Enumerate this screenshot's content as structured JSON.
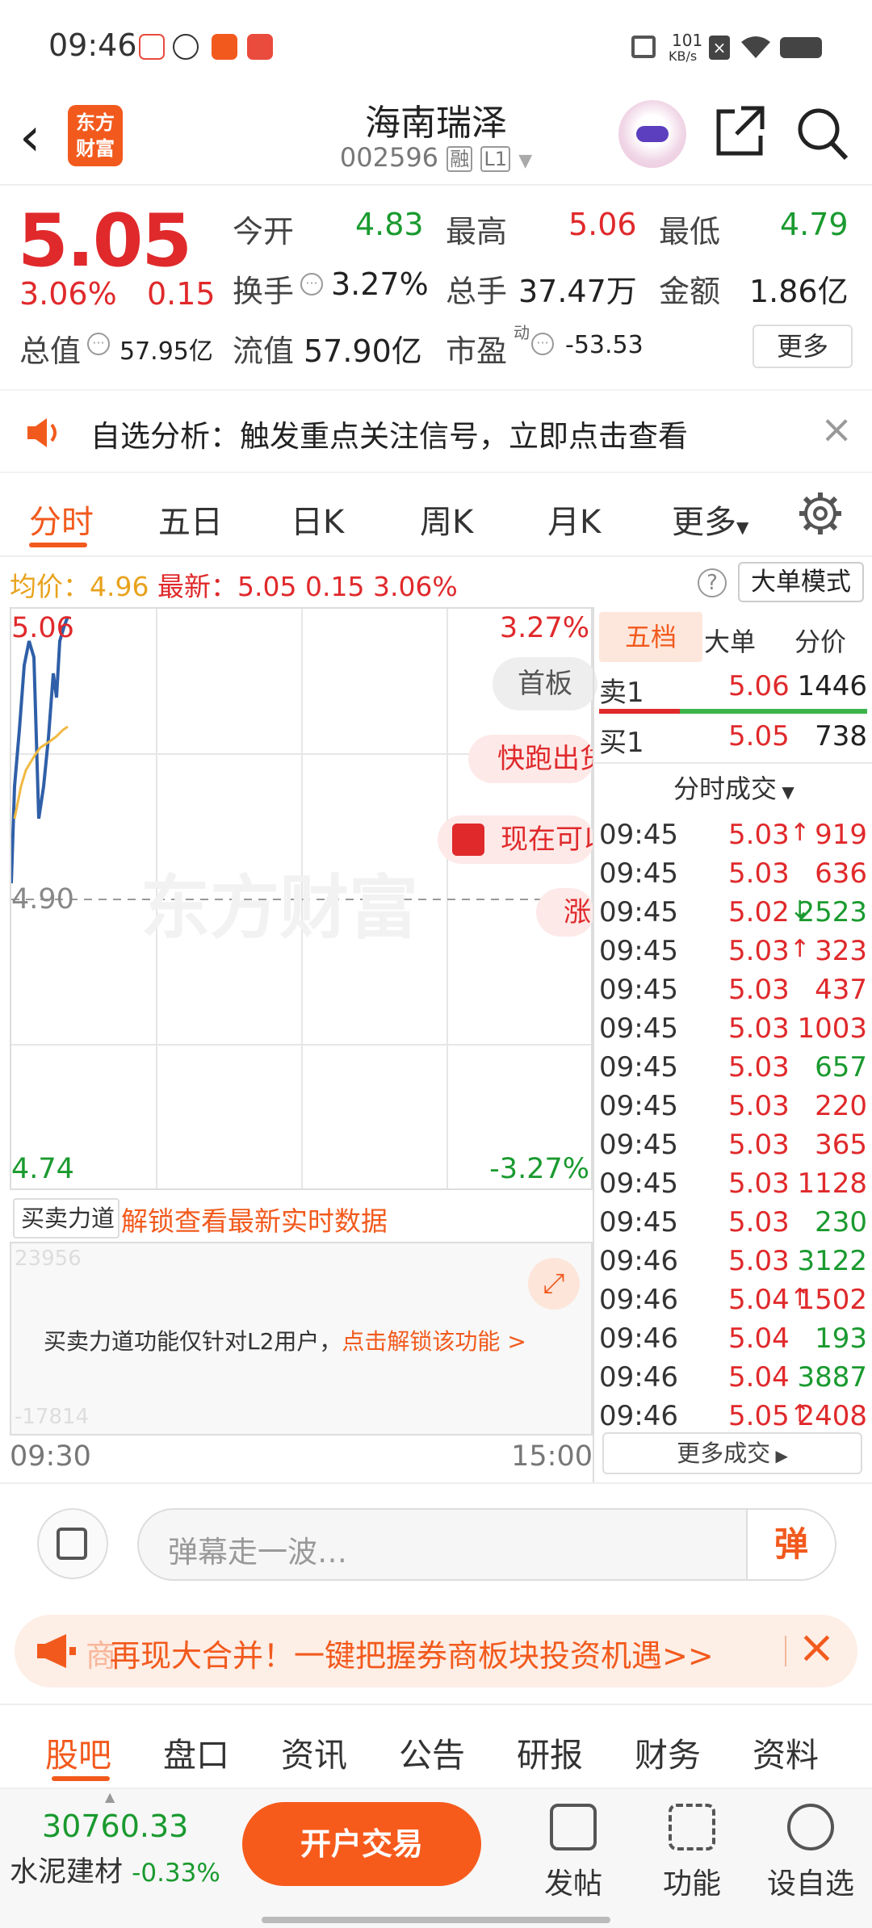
{
  "status_bar": {
    "time": "09:46",
    "net_speed_value": "101",
    "net_speed_unit": "KB/s"
  },
  "header": {
    "logo_text": "东方财富",
    "stock_name": "海南瑞泽",
    "stock_code": "002596",
    "tag_margin": "融",
    "tag_level": "L1"
  },
  "quote": {
    "price": "5.05",
    "change_pct": "3.06%",
    "change": "0.15",
    "open_label": "今开",
    "open": "4.83",
    "high_label": "最高",
    "high": "5.06",
    "low_label": "最低",
    "low": "4.79",
    "turnover_label": "换手",
    "turnover": "3.27%",
    "volume_label": "总手",
    "volume": "37.47万",
    "amount_label": "金额",
    "amount": "1.86亿",
    "mcap_label": "总值",
    "mcap": "57.95亿",
    "float_label": "流值",
    "float_cap": "57.90亿",
    "pe_label": "市盈",
    "pe_super": "动",
    "pe": "-53.53",
    "more_label": "更多"
  },
  "analysis": {
    "text": "自选分析：触发重点关注信号，立即点击查看"
  },
  "period_tabs": [
    "分时",
    "五日",
    "日K",
    "周K",
    "月K",
    "更多"
  ],
  "info_row": {
    "avg_label": "均价：",
    "avg": "4.96",
    "latest_label": "最新：",
    "latest": "5.05",
    "change": "0.15",
    "pct": "3.06%",
    "big_order_mode": "大单模式"
  },
  "chart": {
    "top_price": "5.06",
    "top_pct": "3.27%",
    "mid_price": "4.90",
    "bottom_price": "4.74",
    "bottom_pct": "-3.27%",
    "start_time": "09:30",
    "end_time": "15:00",
    "watermark": "东方财富",
    "badge_board": "首板",
    "pill_1": "快跑出货",
    "pill_2": "现在可以",
    "pill_3": "涨",
    "line_color": "#2f5fa8",
    "avg_color": "#f0b942"
  },
  "force": {
    "select_label": "买卖力道",
    "unlock_label": "解锁查看最新实时数据",
    "notice": "买卖力道功能仅针对L2用户，",
    "notice_link": "点击解锁该功能 >",
    "faint_top": "23956",
    "faint_bottom": "-17814"
  },
  "order_tabs": [
    "五档",
    "大单",
    "分价"
  ],
  "order_book": {
    "sell1_label": "卖1",
    "sell1_price": "5.06",
    "sell1_vol": "1446",
    "buy1_label": "买1",
    "buy1_price": "5.05",
    "buy1_vol": "738"
  },
  "ticks_header": "分时成交",
  "ticks": [
    {
      "time": "09:45",
      "price": "5.03",
      "arrow": "↑",
      "vol": "919",
      "color": "red"
    },
    {
      "time": "09:45",
      "price": "5.03",
      "arrow": "",
      "vol": "636",
      "color": "red"
    },
    {
      "time": "09:45",
      "price": "5.02",
      "arrow": "↓",
      "vol": "2523",
      "color": "green"
    },
    {
      "time": "09:45",
      "price": "5.03",
      "arrow": "↑",
      "vol": "323",
      "color": "red"
    },
    {
      "time": "09:45",
      "price": "5.03",
      "arrow": "",
      "vol": "437",
      "color": "red"
    },
    {
      "time": "09:45",
      "price": "5.03",
      "arrow": "",
      "vol": "1003",
      "color": "red"
    },
    {
      "time": "09:45",
      "price": "5.03",
      "arrow": "",
      "vol": "657",
      "color": "green"
    },
    {
      "time": "09:45",
      "price": "5.03",
      "arrow": "",
      "vol": "220",
      "color": "red"
    },
    {
      "time": "09:45",
      "price": "5.03",
      "arrow": "",
      "vol": "365",
      "color": "red"
    },
    {
      "time": "09:45",
      "price": "5.03",
      "arrow": "",
      "vol": "1128",
      "color": "red"
    },
    {
      "time": "09:45",
      "price": "5.03",
      "arrow": "",
      "vol": "230",
      "color": "green"
    },
    {
      "time": "09:46",
      "price": "5.03",
      "arrow": "",
      "vol": "3122",
      "color": "green"
    },
    {
      "time": "09:46",
      "price": "5.04",
      "arrow": "↑",
      "vol": "1502",
      "color": "red"
    },
    {
      "time": "09:46",
      "price": "5.04",
      "arrow": "",
      "vol": "193",
      "color": "green"
    },
    {
      "time": "09:46",
      "price": "5.04",
      "arrow": "",
      "vol": "3887",
      "color": "green"
    },
    {
      "time": "09:46",
      "price": "5.05",
      "arrow": "↑",
      "vol": "2408",
      "color": "red"
    }
  ],
  "more_trades": "更多成交",
  "comment": {
    "placeholder": "弹幕走一波…",
    "dan_button": "弹"
  },
  "promo": {
    "text": "再现大合并！一键把握券商板块投资机遇>>",
    "prefix": "商"
  },
  "bottom_tabs": [
    "股吧",
    "盘口",
    "资讯",
    "公告",
    "研报",
    "财务",
    "资料"
  ],
  "nav": {
    "index_value": "30760.33",
    "index_name": "水泥建材",
    "index_change": "-0.33%",
    "trade_button": "开户交易",
    "post": "发帖",
    "function": "功能",
    "watchlist": "设自选"
  }
}
